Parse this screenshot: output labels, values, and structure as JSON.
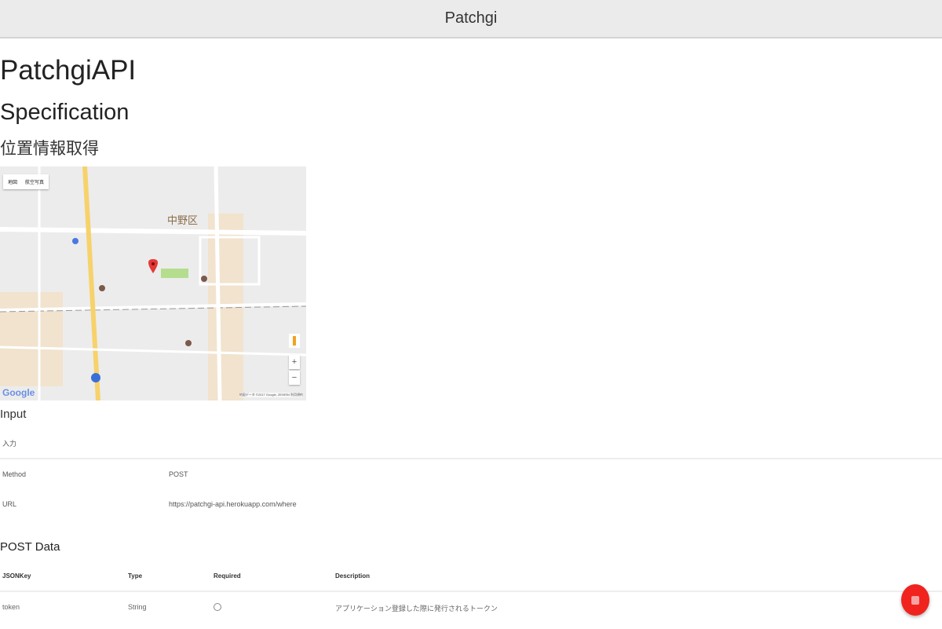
{
  "header": {
    "title": "Patchgi"
  },
  "page": {
    "title": "PatchgiAPI",
    "subtitle": "Specification",
    "section_title": "位置情報取得"
  },
  "map": {
    "type_buttons": [
      "地図",
      "航空写真"
    ],
    "district_label": "中野区",
    "zoom_in": "+",
    "zoom_out": "−",
    "logo": "Google",
    "attribution": "地図データ ©2017 Google, ZENRIN  利用規約"
  },
  "input": {
    "heading": "Input",
    "subheading": "入力",
    "rows": [
      {
        "label": "Method",
        "value": "POST"
      },
      {
        "label": "URL",
        "value": "https://patchgi-api.herokuapp.com/where"
      }
    ]
  },
  "post_data": {
    "heading": "POST Data",
    "columns": [
      "JSONKey",
      "Type",
      "Required",
      "Description"
    ],
    "rows": [
      {
        "key": "token",
        "type": "String",
        "required": false,
        "description": "アプリケーション登録した際に発行されるトークン"
      }
    ]
  },
  "colors": {
    "fab": "#f0231e",
    "header_bg": "#ebebeb",
    "pin": "#e53935"
  }
}
